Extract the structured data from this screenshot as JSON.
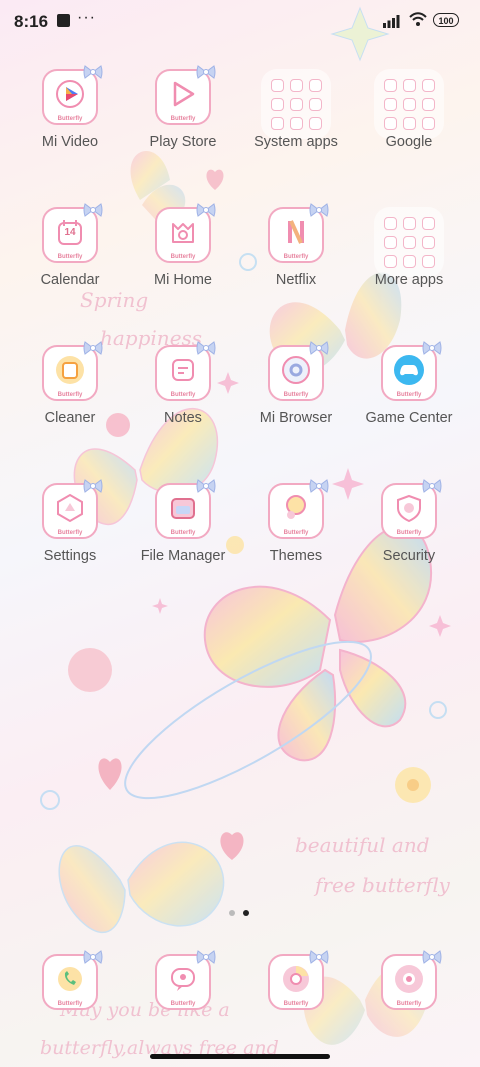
{
  "status_bar": {
    "time": "8:16",
    "more_indicator": "···",
    "battery": "100"
  },
  "home": {
    "apps": [
      {
        "label": "Mi Video",
        "icon": "mi-video-icon"
      },
      {
        "label": "Play Store",
        "icon": "play-store-icon"
      },
      {
        "label": "System apps",
        "icon": "folder-icon"
      },
      {
        "label": "Google",
        "icon": "folder-icon"
      },
      {
        "label": "Calendar",
        "icon": "calendar-icon",
        "badge": "14"
      },
      {
        "label": "Mi Home",
        "icon": "mi-home-icon"
      },
      {
        "label": "Netflix",
        "icon": "netflix-icon"
      },
      {
        "label": "More apps",
        "icon": "folder-icon"
      },
      {
        "label": "Cleaner",
        "icon": "cleaner-icon"
      },
      {
        "label": "Notes",
        "icon": "notes-icon"
      },
      {
        "label": "Mi Browser",
        "icon": "browser-icon"
      },
      {
        "label": "Game Center",
        "icon": "game-center-icon"
      },
      {
        "label": "Settings",
        "icon": "settings-icon"
      },
      {
        "label": "File Manager",
        "icon": "file-manager-icon"
      },
      {
        "label": "Themes",
        "icon": "themes-icon"
      },
      {
        "label": "Security",
        "icon": "security-icon"
      }
    ],
    "icon_caption": "Butterfly"
  },
  "dock": {
    "apps": [
      {
        "icon": "phone-icon"
      },
      {
        "icon": "messages-icon"
      },
      {
        "icon": "chrome-icon"
      },
      {
        "icon": "music-icon"
      }
    ]
  },
  "wallpaper": {
    "text_1": "Spring",
    "text_2": "happiness",
    "text_3": "beautiful and",
    "text_4": "free butterfly",
    "text_5": "May you be like a",
    "text_6": "butterfly,always free and"
  },
  "pages": {
    "count": 2,
    "active": 2
  },
  "colors": {
    "accent": "#f2a9c2",
    "text": "#555555",
    "bow": "#b9c8f0"
  }
}
